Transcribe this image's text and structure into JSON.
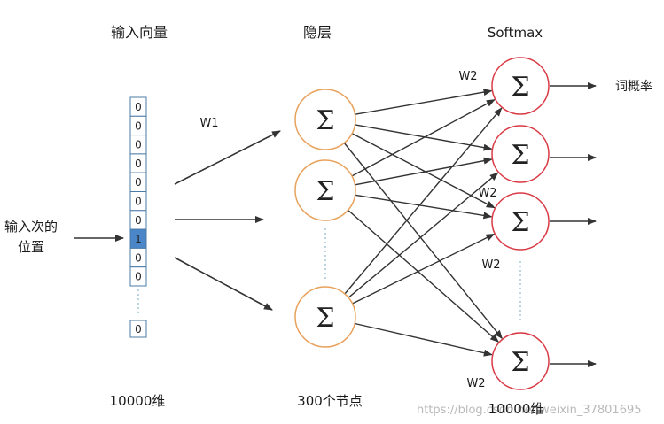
{
  "headers": {
    "input": "输入向量",
    "hidden": "隐层",
    "softmax": "Softmax"
  },
  "input_position_label": [
    "输入次的",
    "位置"
  ],
  "input_vector": {
    "cells": [
      "0",
      "0",
      "0",
      "0",
      "0",
      "0",
      "0",
      "1",
      "0",
      "0"
    ],
    "last_cell": "0",
    "highlight_color": "#4a86c8"
  },
  "weights": {
    "w1": "W1",
    "w2": "W2"
  },
  "output_label": "词概率",
  "neuron_symbol": "Σ",
  "bottom": {
    "input_dim": "10000维",
    "hidden_nodes": "300个节点",
    "output_dim": "10000维"
  },
  "watermark": "https://blog.csdn.net/weixin_37801695",
  "colors": {
    "hidden_neuron": "#e8a25c",
    "output_neuron": "#d93a45",
    "cell_border": "#4a7ba7"
  }
}
